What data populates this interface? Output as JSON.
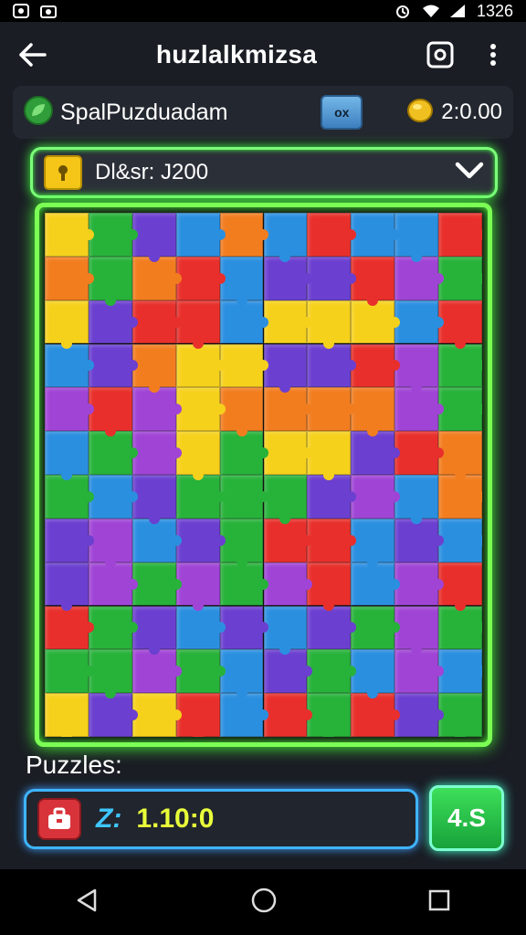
{
  "status_bar": {
    "time": "1326"
  },
  "app_bar": {
    "title": "huzlalkmizsa"
  },
  "info_bar": {
    "player_name": "SpalPuzduadam",
    "badge_text": "ox",
    "coins": "2:0.00"
  },
  "selector": {
    "label": "Dl&sr: J200"
  },
  "board": {
    "rows": 12,
    "cols": 10,
    "palette": [
      "#f6d11c",
      "#27b23a",
      "#6b3fd0",
      "#2b8fe0",
      "#e82f2b",
      "#f27d1f",
      "#a044d6",
      "#3ec6b5",
      "#f7b21a",
      "#1e9e35"
    ],
    "cells": [
      0,
      1,
      2,
      3,
      5,
      3,
      4,
      3,
      3,
      4,
      5,
      1,
      5,
      4,
      3,
      2,
      2,
      4,
      6,
      1,
      0,
      2,
      4,
      4,
      3,
      0,
      0,
      0,
      3,
      4,
      3,
      2,
      5,
      0,
      0,
      2,
      2,
      4,
      6,
      1,
      6,
      4,
      6,
      0,
      5,
      5,
      5,
      5,
      6,
      1,
      3,
      1,
      6,
      0,
      1,
      0,
      0,
      2,
      4,
      5,
      1,
      3,
      2,
      1,
      1,
      1,
      2,
      6,
      3,
      5,
      2,
      6,
      3,
      2,
      1,
      4,
      4,
      3,
      2,
      3,
      2,
      6,
      1,
      6,
      1,
      6,
      4,
      3,
      6,
      4,
      4,
      1,
      2,
      3,
      2,
      3,
      2,
      1,
      6,
      1,
      1,
      1,
      6,
      1,
      3,
      2,
      1,
      3,
      6,
      3,
      0,
      2,
      0,
      4,
      3,
      4,
      1,
      4,
      2,
      1
    ]
  },
  "bottom": {
    "puzzles_label": "Puzzles:",
    "field_prefix": "Z:",
    "field_value": "1.10:0",
    "button_label": "4.S"
  }
}
